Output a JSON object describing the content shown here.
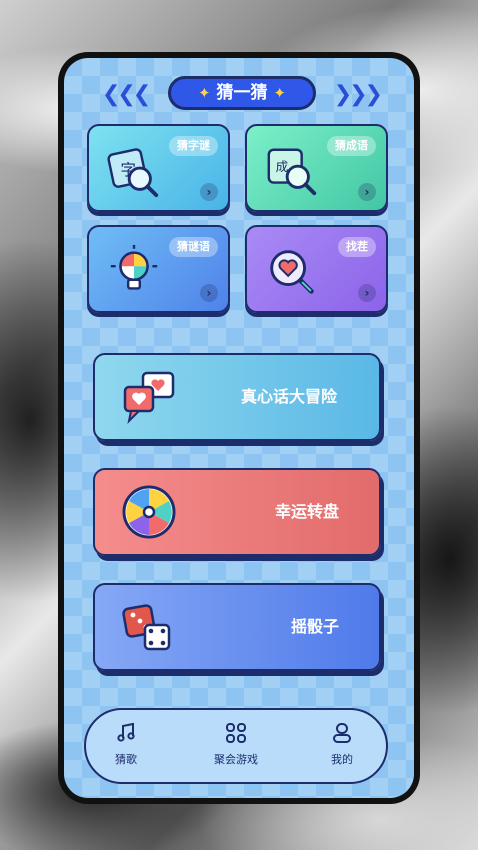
{
  "header": {
    "title": "猜一猜",
    "left_chevrons": "❮❮❮",
    "right_chevrons": "❯❯❯",
    "sparkle": "✦"
  },
  "cards": [
    {
      "label": "猜字谜",
      "icon": "character-magnifier-icon",
      "arrow": "›"
    },
    {
      "label": "猜成语",
      "icon": "idiom-magnifier-icon",
      "arrow": "›"
    },
    {
      "label": "猜谜语",
      "icon": "puzzle-bulb-icon",
      "arrow": "›"
    },
    {
      "label": "找茬",
      "icon": "heart-magnifier-icon",
      "arrow": "›"
    }
  ],
  "card_glyphs": {
    "char": "字",
    "idiom": "成"
  },
  "games": [
    {
      "label": "真心话大冒险",
      "icon": "chat-hearts-icon"
    },
    {
      "label": "幸运转盘",
      "icon": "wheel-icon"
    },
    {
      "label": "摇骰子",
      "icon": "dice-icon"
    }
  ],
  "tabs": [
    {
      "label": "猜歌",
      "icon": "music-note-icon"
    },
    {
      "label": "聚会游戏",
      "icon": "grid-icon"
    },
    {
      "label": "我的",
      "icon": "user-icon"
    }
  ],
  "colors": {
    "accent": "#2f57e8",
    "outline": "#1d2c6b"
  }
}
